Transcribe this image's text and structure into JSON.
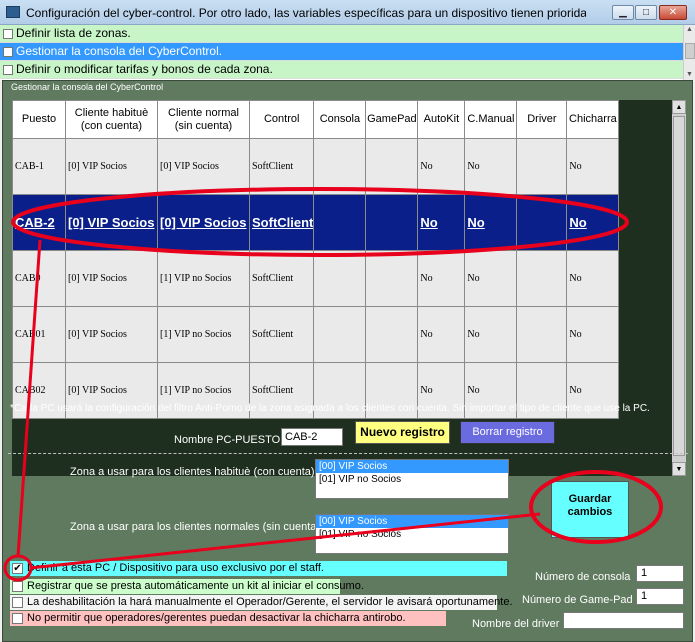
{
  "window": {
    "title": "Configuración del cyber-control. Por otro lado, las variables específicas para un dispositivo tienen priorida...",
    "min_glyph": "▁",
    "max_glyph": "□",
    "close_glyph": "✕"
  },
  "zones": [
    {
      "label": "Definir lista de zonas.",
      "checked": false
    },
    {
      "label": "Gestionar la consola del CyberControl.",
      "checked": true,
      "selected": true
    },
    {
      "label": "Definir o modificar tarifas y bonos de cada zona.",
      "checked": false
    }
  ],
  "panel": {
    "legend": "Gestionar la consola del CyberControl"
  },
  "grid": {
    "headers": [
      "Puesto",
      "Cliente habituè (con cuenta)",
      "Cliente normal (sin cuenta)",
      "Control",
      "Consola",
      "GamePad",
      "AutoKit",
      "C.Manual",
      "Driver",
      "Chicharra"
    ],
    "rows": [
      [
        "CAB-1",
        "[0] VIP Socios",
        "[0] VIP Socios",
        "SoftClient",
        "",
        "",
        "No",
        "No",
        "",
        "No"
      ],
      [
        "CAB-2",
        "[0] VIP Socios",
        "[0] VIP Socios",
        "SoftClient",
        "",
        "",
        "No",
        "No",
        "",
        "No"
      ],
      [
        "CAB0",
        "[0] VIP Socios",
        "[1] VIP no Socios",
        "SoftClient",
        "",
        "",
        "No",
        "No",
        "",
        "No"
      ],
      [
        "CAB01",
        "[0] VIP Socios",
        "[1] VIP no Socios",
        "SoftClient",
        "",
        "",
        "No",
        "No",
        "",
        "No"
      ],
      [
        "CAB02",
        "[0] VIP Socios",
        "[1] VIP no Socios",
        "SoftClient",
        "",
        "",
        "No",
        "No",
        "",
        "No"
      ]
    ],
    "selected_row": 1
  },
  "note": "*Cada PC usará la configuración del filtro Anti-Porno de la zona asignada a los clientes con cuenta. Sin importar el tipo de cliente que use la PC.",
  "form": {
    "nombre_label": "Nombre PC-PUESTO",
    "nombre_value": "CAB-2",
    "nuevo_label": "Nuevo registro",
    "borrar_label": "Borrar registro",
    "zona_habitue_label": "Zona a usar para los clientes habituè (con cuenta)",
    "zona_habitue_options": [
      "[00] VIP Socios",
      "[01] VIP no Socios"
    ],
    "zona_normal_label": "Zona a usar para los clientes normales (sin cuenta)",
    "zona_normal_options": [
      "[00] VIP Socios",
      "[01] VIP no Socios"
    ],
    "guardar_label": "Guardar cambios",
    "options": [
      {
        "label": "Definir a esta PC / Dispositivo para uso exclusivo por el staff.",
        "checked": true
      },
      {
        "label": "Registrar que se presta automáticamente un kit al iniciar el consumo.",
        "checked": false
      },
      {
        "label": "La deshabilitación la hará manualmente el Operador/Gerente, el servidor le avisará oportunamente.",
        "checked": false
      },
      {
        "label": "No permitir que operadores/gerentes puedan desactivar la chicharra antirobo.",
        "checked": false
      }
    ],
    "consola_label": "Número de consola",
    "consola_value": "1",
    "gamepad_label": "Número de Game-Pad",
    "gamepad_value": "1",
    "driver_label": "Nombre del driver",
    "driver_value": ""
  },
  "colors": {
    "annotation": "#e8001c",
    "selected_row": "#0a1f8a",
    "panel": "#5f7a5f"
  }
}
